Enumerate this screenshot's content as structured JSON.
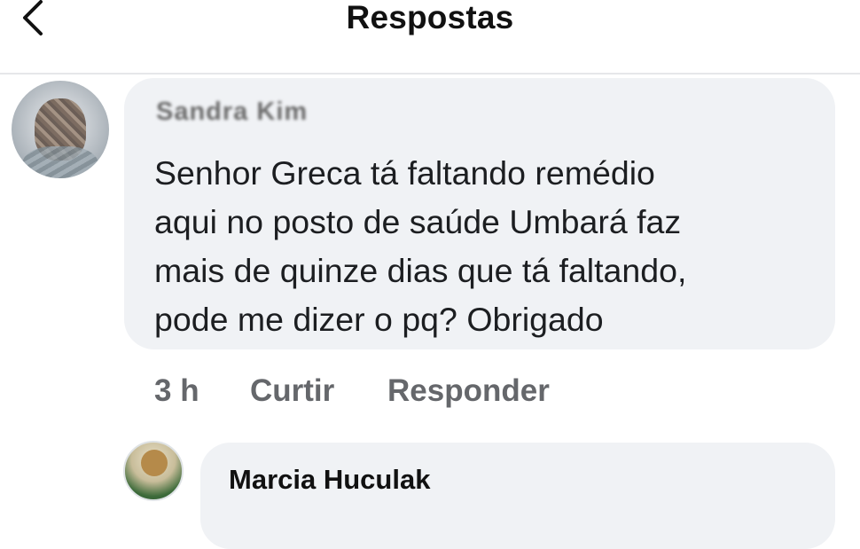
{
  "header": {
    "title": "Respostas",
    "back_icon": "chevron-left-icon"
  },
  "comment": {
    "author": "Sandra Kim",
    "text": "Senhor Greca tá faltando remédio\naqui no posto de saúde Umbará faz\nmais de quinze dias que tá faltando,\npode me dizer o pq? Obrigado",
    "time": "3 h",
    "like_label": "Curtir",
    "reply_label": "Responder"
  },
  "reply": {
    "author": "Marcia Huculak"
  },
  "colors": {
    "bubble": "#f0f2f5",
    "action_text": "#65676b",
    "text": "#1c1e21"
  }
}
